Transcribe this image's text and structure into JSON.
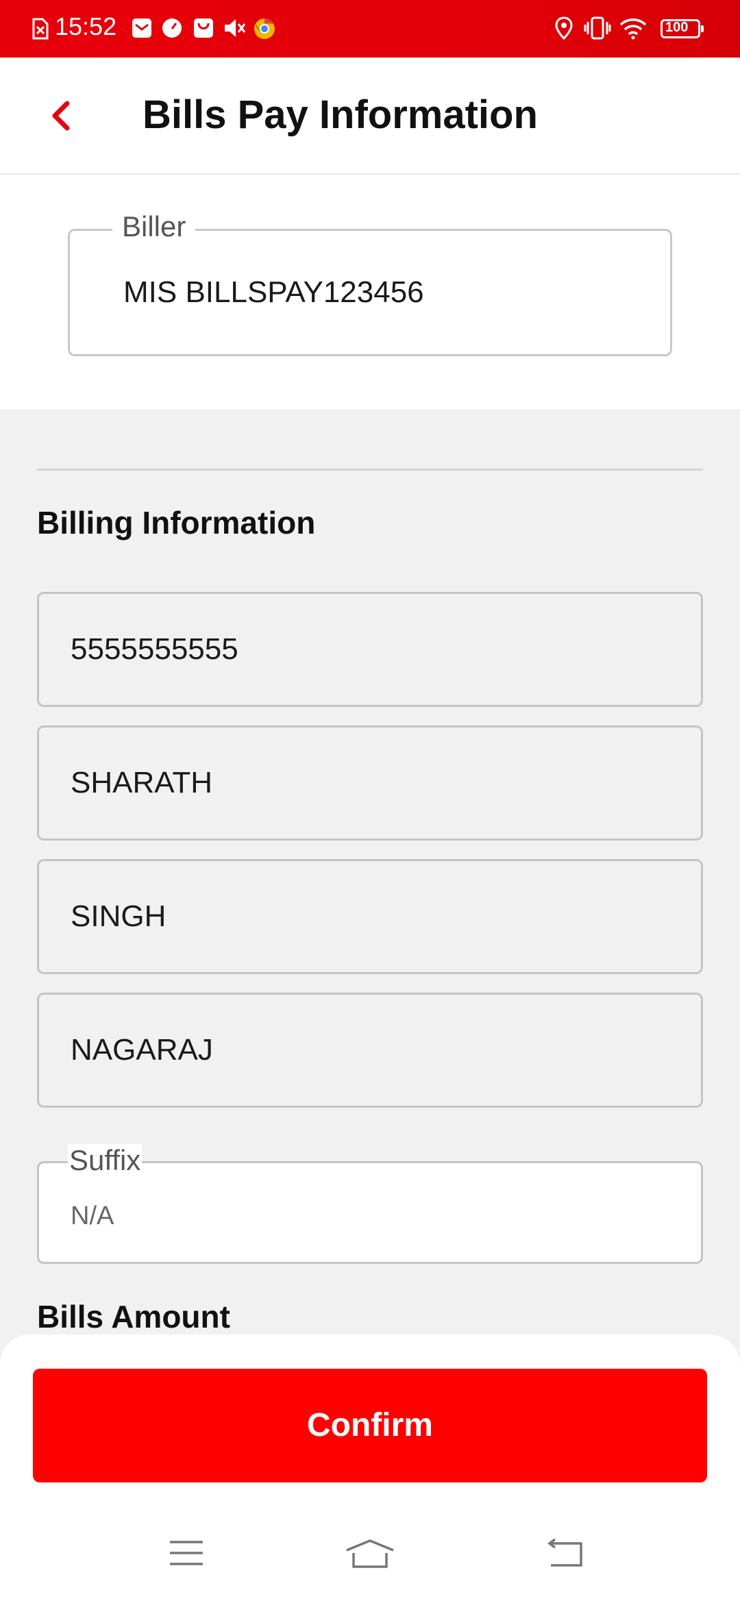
{
  "status_bar": {
    "time": "15:52",
    "battery": "100",
    "left_icons": [
      "sim-blocked-icon",
      "mail-icon",
      "speedometer-icon",
      "shopping-bag-icon",
      "mute-icon",
      "chrome-icon"
    ],
    "right_icons": [
      "location-icon",
      "vibrate-icon",
      "wifi-icon",
      "battery-icon"
    ]
  },
  "app_bar": {
    "title": "Bills Pay Information",
    "back_icon": "chevron-left-icon",
    "accent_color": "#e60012"
  },
  "biller": {
    "label": "Biller",
    "value": "MIS BILLSPAY123456"
  },
  "billing_information": {
    "title": "Billing Information",
    "fields": [
      {
        "value": "5555555555"
      },
      {
        "value": "SHARATH"
      },
      {
        "value": "SINGH"
      },
      {
        "value": "NAGARAJ"
      }
    ],
    "suffix": {
      "label": "Suffix",
      "value": "N/A"
    }
  },
  "bills_amount": {
    "title": "Bills Amount"
  },
  "footer": {
    "confirm_label": "Confirm",
    "confirm_color": "#ff0000"
  },
  "system_nav": [
    "menu-icon",
    "home-icon",
    "back-icon"
  ]
}
